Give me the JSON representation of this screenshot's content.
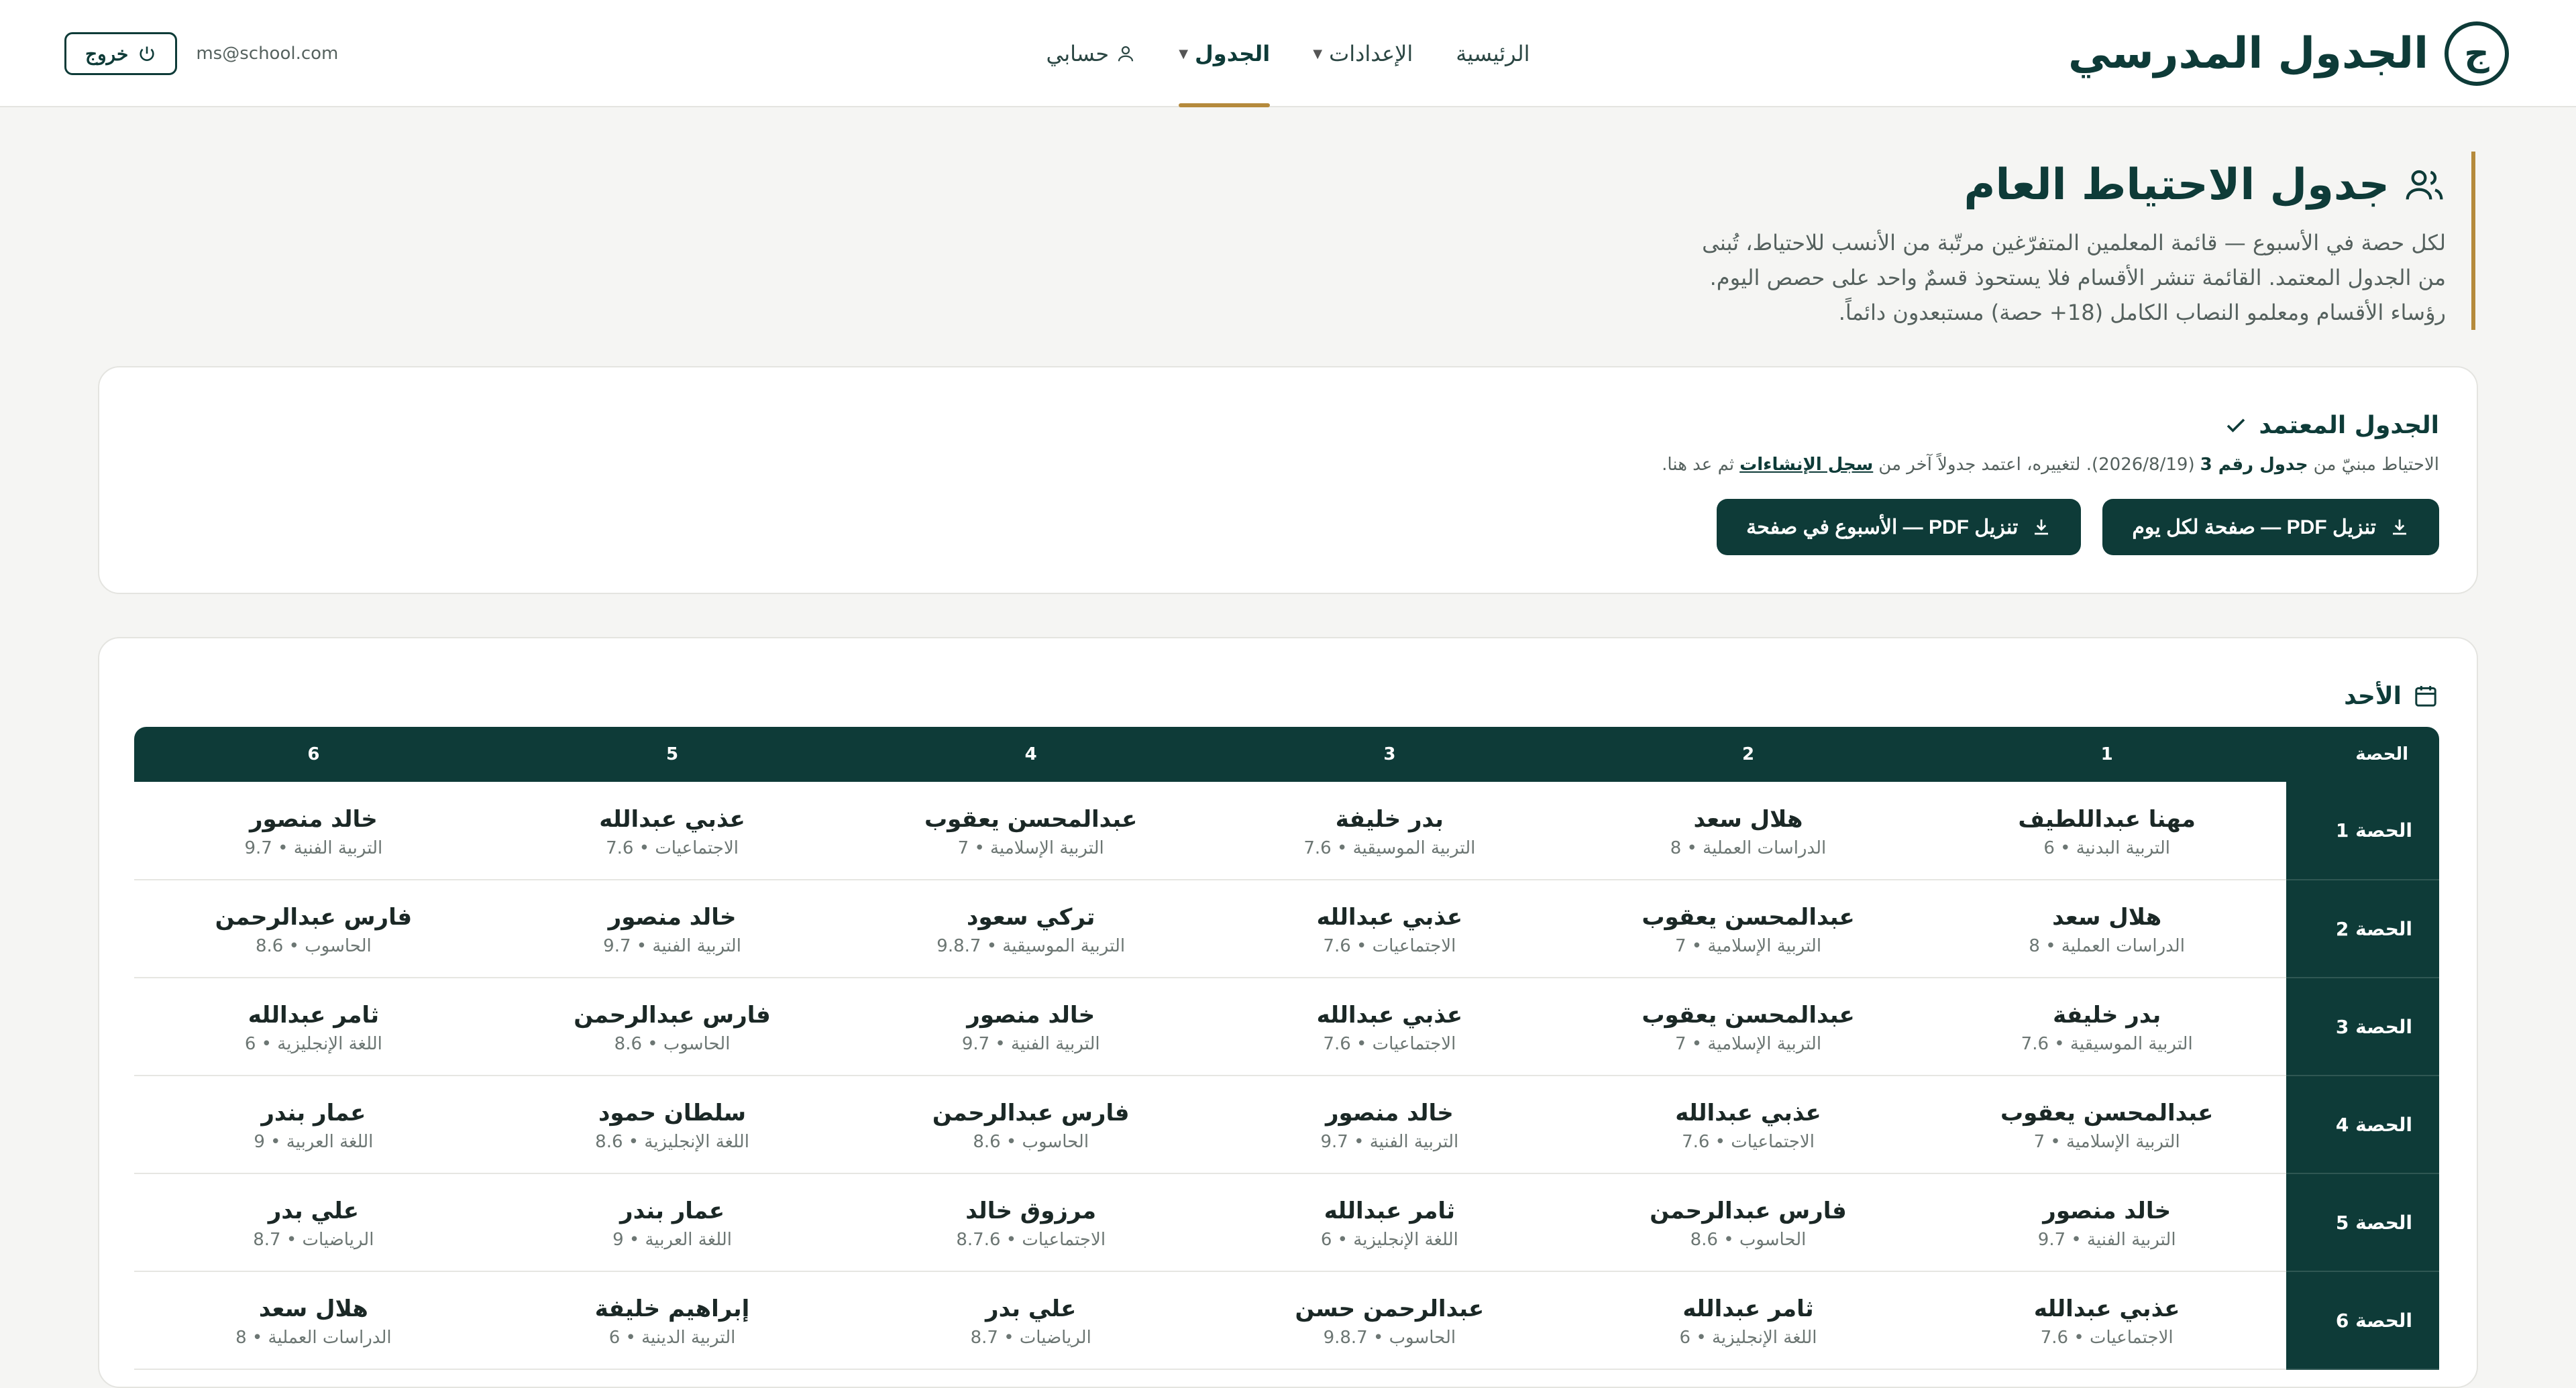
{
  "header": {
    "brand_logo": "ج",
    "brand_title": "الجدول المدرسي",
    "nav": [
      {
        "label": "الرئيسية",
        "has_caret": false
      },
      {
        "label": "الإعدادات",
        "has_caret": true
      },
      {
        "label": "الجدول",
        "has_caret": true,
        "active": true
      },
      {
        "label": "حسابي",
        "has_icon": "user-icon"
      }
    ],
    "logout_label": "خروج",
    "email": "ms@school.com"
  },
  "intro": {
    "title": "جدول الاحتياط العام",
    "desc_lines": [
      "لكل حصة في الأسبوع — قائمة المعلمين المتفرّغين مرتّبة من الأنسب للاحتياط، تُبنى",
      "من الجدول المعتمد. القائمة تنشر الأقسام فلا يستحوذ قسمٌ واحد على حصص اليوم.",
      "رؤساء الأقسام ومعلمو النصاب الكامل (18+ حصة) مستبعدون دائماً."
    ]
  },
  "approved": {
    "title": "الجدول المعتمد",
    "note_prefix": "الاحتياط مبنيّ من",
    "note_bold": "جدول رقم 3",
    "note_middle": "(2026/8/19). لتغييره، اعتمد جدولاً آخر من",
    "note_link": "سجل الإنشاءات",
    "note_suffix": "ثم عد هنا.",
    "btn_per_day": "تنزيل PDF — صفحة لكل يوم",
    "btn_week": "تنزيل PDF — الأسبوع في صفحة"
  },
  "timetable": {
    "day": "الأحد",
    "corner_header": "الحصة",
    "columns": [
      "1",
      "2",
      "3",
      "4",
      "5",
      "6"
    ],
    "rows": [
      {
        "label": "الحصة 1",
        "cells": [
          {
            "name": "مهنا عبداللطيف",
            "sub": "التربية البدنية • 6"
          },
          {
            "name": "هلال سعد",
            "sub": "الدراسات العملية • 8"
          },
          {
            "name": "بدر خليفة",
            "sub": "التربية الموسيقية • 7.6"
          },
          {
            "name": "عبدالمحسن يعقوب",
            "sub": "التربية الإسلامية • 7"
          },
          {
            "name": "عذبي عبدالله",
            "sub": "الاجتماعيات • 7.6"
          },
          {
            "name": "خالد منصور",
            "sub": "التربية الفنية • 9.7"
          }
        ]
      },
      {
        "label": "الحصة 2",
        "cells": [
          {
            "name": "هلال سعد",
            "sub": "الدراسات العملية • 8"
          },
          {
            "name": "عبدالمحسن يعقوب",
            "sub": "التربية الإسلامية • 7"
          },
          {
            "name": "عذبي عبدالله",
            "sub": "الاجتماعيات • 7.6"
          },
          {
            "name": "تركي سعود",
            "sub": "التربية الموسيقية • 9.8.7"
          },
          {
            "name": "خالد منصور",
            "sub": "التربية الفنية • 9.7"
          },
          {
            "name": "فارس عبدالرحمن",
            "sub": "الحاسوب • 8.6"
          }
        ]
      },
      {
        "label": "الحصة 3",
        "cells": [
          {
            "name": "بدر خليفة",
            "sub": "التربية الموسيقية • 7.6"
          },
          {
            "name": "عبدالمحسن يعقوب",
            "sub": "التربية الإسلامية • 7"
          },
          {
            "name": "عذبي عبدالله",
            "sub": "الاجتماعيات • 7.6"
          },
          {
            "name": "خالد منصور",
            "sub": "التربية الفنية • 9.7"
          },
          {
            "name": "فارس عبدالرحمن",
            "sub": "الحاسوب • 8.6"
          },
          {
            "name": "ثامر عبدالله",
            "sub": "اللغة الإنجليزية • 6"
          }
        ]
      },
      {
        "label": "الحصة 4",
        "cells": [
          {
            "name": "عبدالمحسن يعقوب",
            "sub": "التربية الإسلامية • 7"
          },
          {
            "name": "عذبي عبدالله",
            "sub": "الاجتماعيات • 7.6"
          },
          {
            "name": "خالد منصور",
            "sub": "التربية الفنية • 9.7"
          },
          {
            "name": "فارس عبدالرحمن",
            "sub": "الحاسوب • 8.6"
          },
          {
            "name": "سلطان حمود",
            "sub": "اللغة الإنجليزية • 8.6"
          },
          {
            "name": "عمار بندر",
            "sub": "اللغة العربية • 9"
          }
        ]
      },
      {
        "label": "الحصة 5",
        "cells": [
          {
            "name": "خالد منصور",
            "sub": "التربية الفنية • 9.7"
          },
          {
            "name": "فارس عبدالرحمن",
            "sub": "الحاسوب • 8.6"
          },
          {
            "name": "ثامر عبدالله",
            "sub": "اللغة الإنجليزية • 6"
          },
          {
            "name": "مرزوق خالد",
            "sub": "الاجتماعيات • 8.7.6"
          },
          {
            "name": "عمار بندر",
            "sub": "اللغة العربية • 9"
          },
          {
            "name": "علي بدر",
            "sub": "الرياضيات • 8.7"
          }
        ]
      },
      {
        "label": "الحصة 6",
        "cells": [
          {
            "name": "عذبي عبدالله",
            "sub": "الاجتماعيات • 7.6"
          },
          {
            "name": "ثامر عبدالله",
            "sub": "اللغة الإنجليزية • 6"
          },
          {
            "name": "عبدالرحمن حسن",
            "sub": "الحاسوب • 9.8.7"
          },
          {
            "name": "علي بدر",
            "sub": "الرياضيات • 8.7"
          },
          {
            "name": "إبراهيم خليفة",
            "sub": "التربية الدينية • 6"
          },
          {
            "name": "هلال سعد",
            "sub": "الدراسات العملية • 8"
          }
        ]
      }
    ]
  },
  "colors": {
    "primary": "#0e3b38",
    "accent": "#b58a3c",
    "background": "#f5f5f3"
  }
}
